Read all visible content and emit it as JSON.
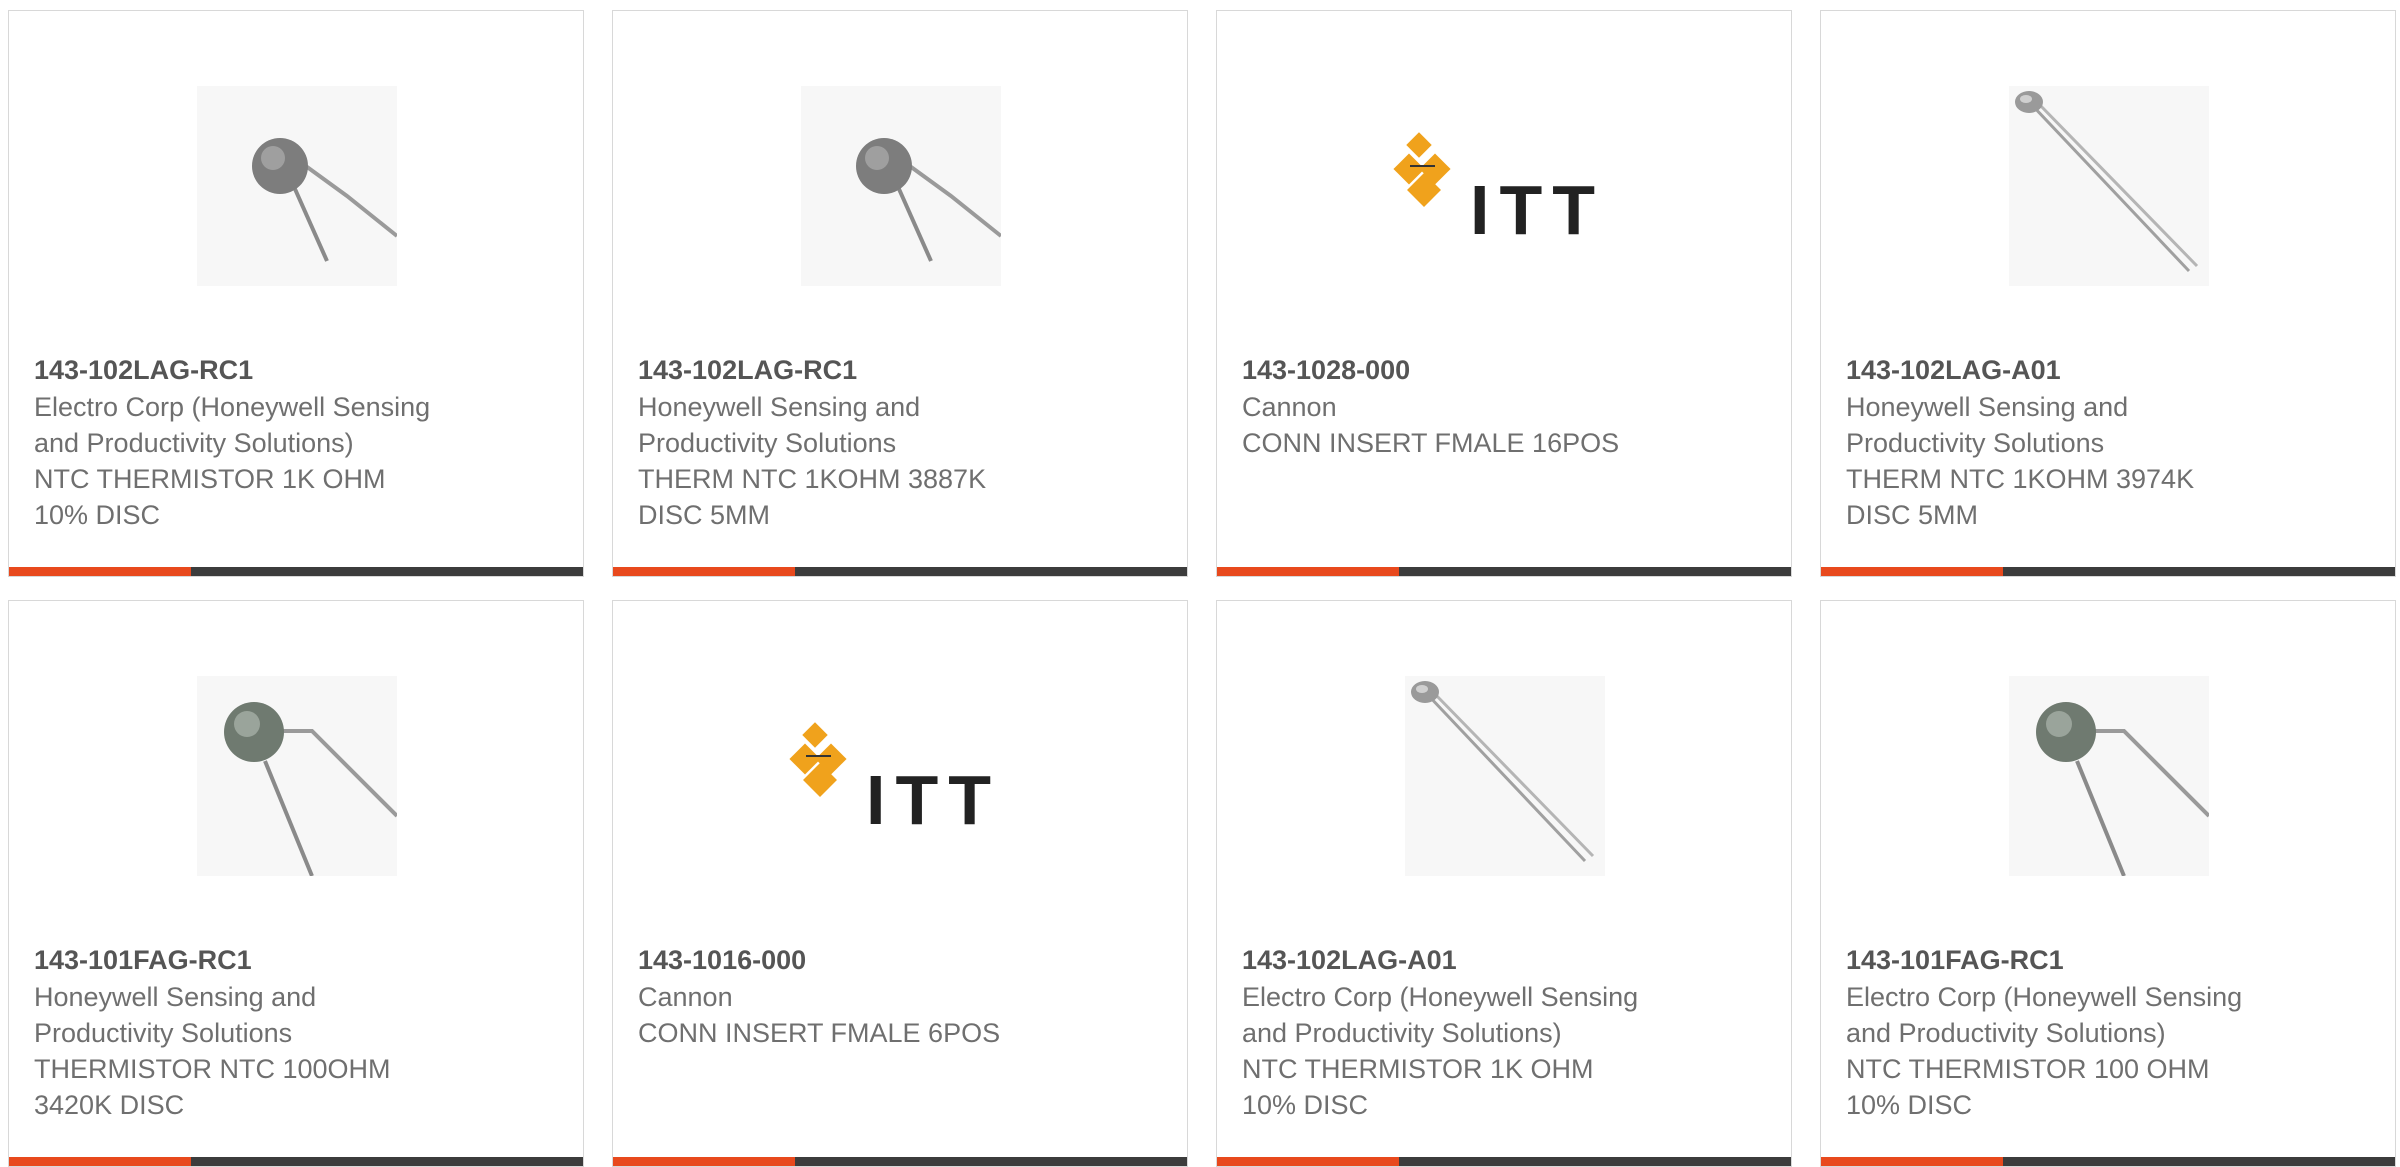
{
  "accent_color": "#e8491d",
  "bar_color": "#3c3c3c",
  "products": [
    {
      "part_number": "143-102LAG-RC1",
      "manufacturer_lines": [
        "Electro Corp (Honeywell Sensing",
        "and Productivity Solutions)"
      ],
      "description_lines": [
        "NTC THERMISTOR 1K OHM",
        "10% DISC"
      ],
      "image": "thermistor-disc-icon"
    },
    {
      "part_number": "143-102LAG-RC1",
      "manufacturer_lines": [
        "Honeywell Sensing and",
        "Productivity Solutions"
      ],
      "description_lines": [
        "THERM NTC 1KOHM 3887K",
        "DISC 5MM"
      ],
      "image": "thermistor-disc-icon"
    },
    {
      "part_number": "143-1028-000",
      "manufacturer_lines": [
        "Cannon"
      ],
      "description_lines": [
        "CONN INSERT FMALE 16POS"
      ],
      "image": "itt-logo",
      "logo_text": "ITT"
    },
    {
      "part_number": "143-102LAG-A01",
      "manufacturer_lines": [
        "Honeywell Sensing and",
        "Productivity Solutions"
      ],
      "description_lines": [
        "THERM NTC 1KOHM 3974K",
        "DISC 5MM"
      ],
      "image": "thermistor-probe-icon"
    },
    {
      "part_number": "143-101FAG-RC1",
      "manufacturer_lines": [
        "Honeywell Sensing and",
        "Productivity Solutions"
      ],
      "description_lines": [
        "THERMISTOR NTC 100OHM",
        "3420K DISC"
      ],
      "image": "thermistor-disc-icon"
    },
    {
      "part_number": "143-1016-000",
      "manufacturer_lines": [
        "Cannon"
      ],
      "description_lines": [
        "CONN INSERT FMALE 6POS"
      ],
      "image": "itt-logo",
      "logo_text": "ITT"
    },
    {
      "part_number": "143-102LAG-A01",
      "manufacturer_lines": [
        "Electro Corp (Honeywell Sensing",
        "and Productivity Solutions)"
      ],
      "description_lines": [
        "NTC THERMISTOR 1K OHM",
        "10% DISC"
      ],
      "image": "thermistor-probe-icon"
    },
    {
      "part_number": "143-101FAG-RC1",
      "manufacturer_lines": [
        "Electro Corp (Honeywell Sensing",
        "and Productivity Solutions)"
      ],
      "description_lines": [
        "NTC THERMISTOR 100 OHM",
        "10% DISC"
      ],
      "image": "thermistor-disc-icon"
    }
  ]
}
